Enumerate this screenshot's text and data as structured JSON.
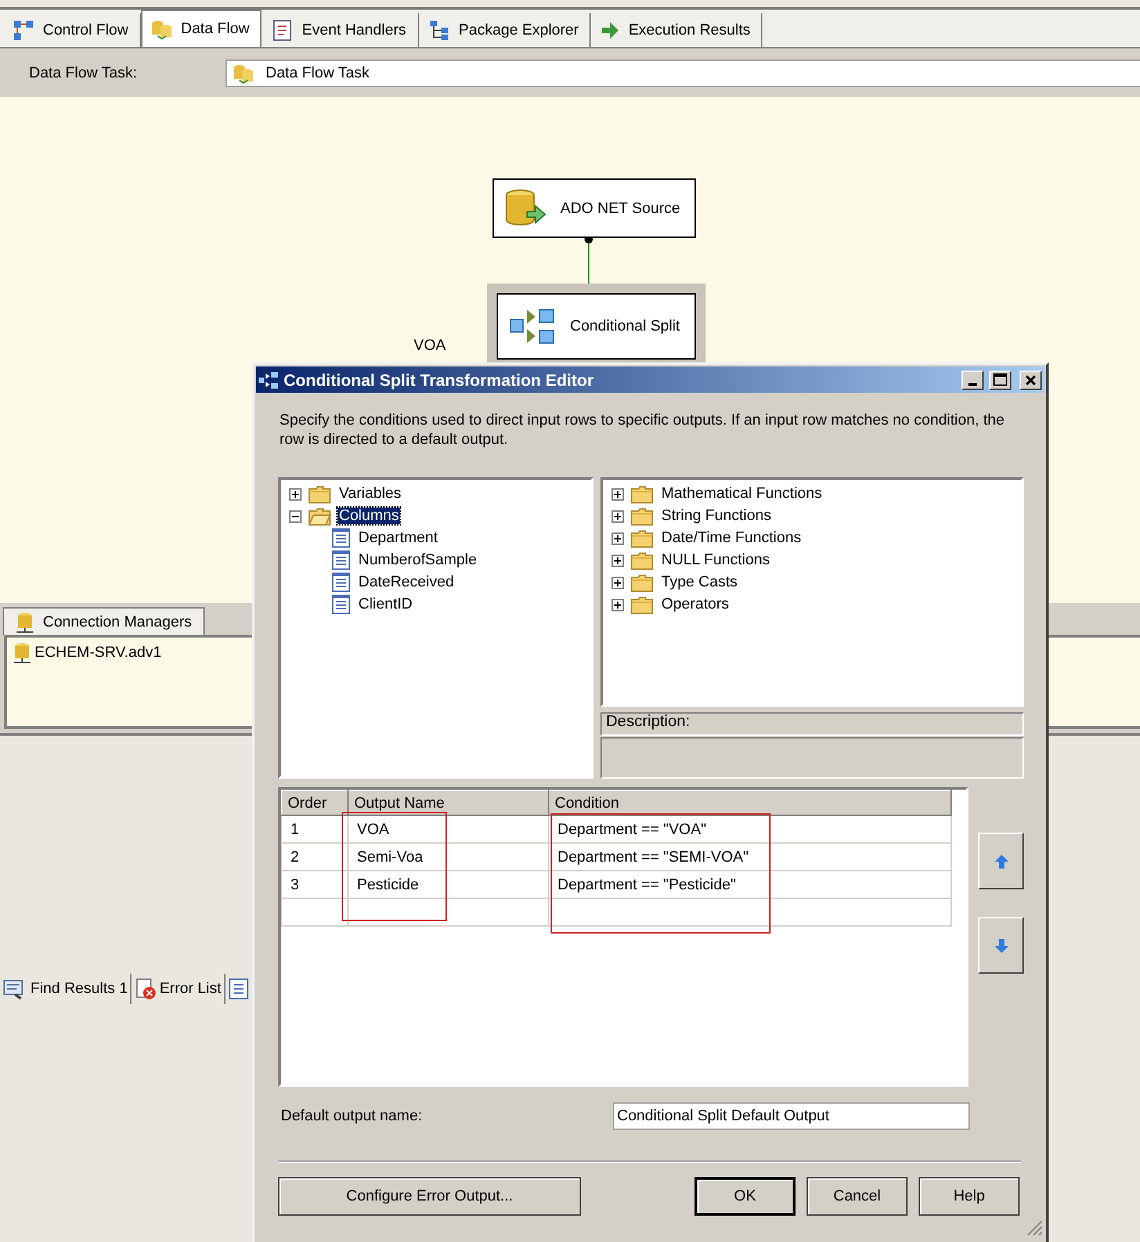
{
  "designer_tabs": [
    {
      "label": "Control Flow",
      "kind": "control",
      "selected": false
    },
    {
      "label": "Data Flow",
      "kind": "data",
      "selected": true
    },
    {
      "label": "Event Handlers",
      "kind": "events",
      "selected": false
    },
    {
      "label": "Package Explorer",
      "kind": "explorer",
      "selected": false
    },
    {
      "label": "Execution Results",
      "kind": "results",
      "selected": false
    }
  ],
  "task_selector": {
    "label": "Data Flow Task:",
    "value": "Data Flow Task"
  },
  "canvas": {
    "nodes": [
      {
        "kind": "source",
        "label": "ADO NET Source",
        "selected": false
      },
      {
        "kind": "split",
        "label": "Conditional Split",
        "selected": true
      }
    ],
    "path_label": "VOA"
  },
  "connection_managers": {
    "tab": "Connection Managers",
    "items": [
      "ECHEM-SRV.adv1"
    ]
  },
  "bottom_tabs": [
    {
      "label": "Find Results 1",
      "kind": "find"
    },
    {
      "label": "Error List",
      "kind": "errors"
    },
    {
      "kind": "output"
    }
  ],
  "dialog": {
    "title": "Conditional Split Transformation Editor",
    "intro": "Specify the conditions used to direct input rows to specific outputs. If an input row matches no condition, the row is directed to a default output.",
    "input_tree": [
      {
        "label": "Variables",
        "expanded": false,
        "selected": false
      },
      {
        "label": "Columns",
        "expanded": true,
        "selected": true,
        "children": [
          {
            "label": "Department",
            "selected": false
          },
          {
            "label": "NumberofSample",
            "selected": false
          },
          {
            "label": "DateReceived",
            "selected": false
          },
          {
            "label": "ClientID",
            "selected": false
          }
        ]
      }
    ],
    "function_tree": [
      {
        "label": "Mathematical Functions",
        "expanded": false
      },
      {
        "label": "String Functions",
        "expanded": false
      },
      {
        "label": "Date/Time Functions",
        "expanded": false
      },
      {
        "label": "NULL Functions",
        "expanded": false
      },
      {
        "label": "Type Casts",
        "expanded": false
      },
      {
        "label": "Operators",
        "expanded": false
      }
    ],
    "description_label": "Description:",
    "grid": {
      "columns": [
        {
          "label": "Order",
          "annotated": false
        },
        {
          "label": "Output Name",
          "annotated": true
        },
        {
          "label": "Condition",
          "annotated": true
        }
      ],
      "rows": [
        [
          "1",
          "VOA",
          "Department == \"VOA\""
        ],
        [
          "2",
          "Semi-Voa",
          "Department == \"SEMI-VOA\""
        ],
        [
          "3",
          "Pesticide",
          "Department == \"Pesticide\""
        ]
      ]
    },
    "default_output": {
      "label": "Default output name:",
      "value": "Conditional Split Default Output"
    },
    "buttons": [
      {
        "label": "Configure Error Output...",
        "kind": "wide"
      },
      {
        "label": "OK",
        "kind": "default"
      },
      {
        "label": "Cancel",
        "kind": "normal"
      },
      {
        "label": "Help",
        "kind": "normal"
      }
    ]
  }
}
